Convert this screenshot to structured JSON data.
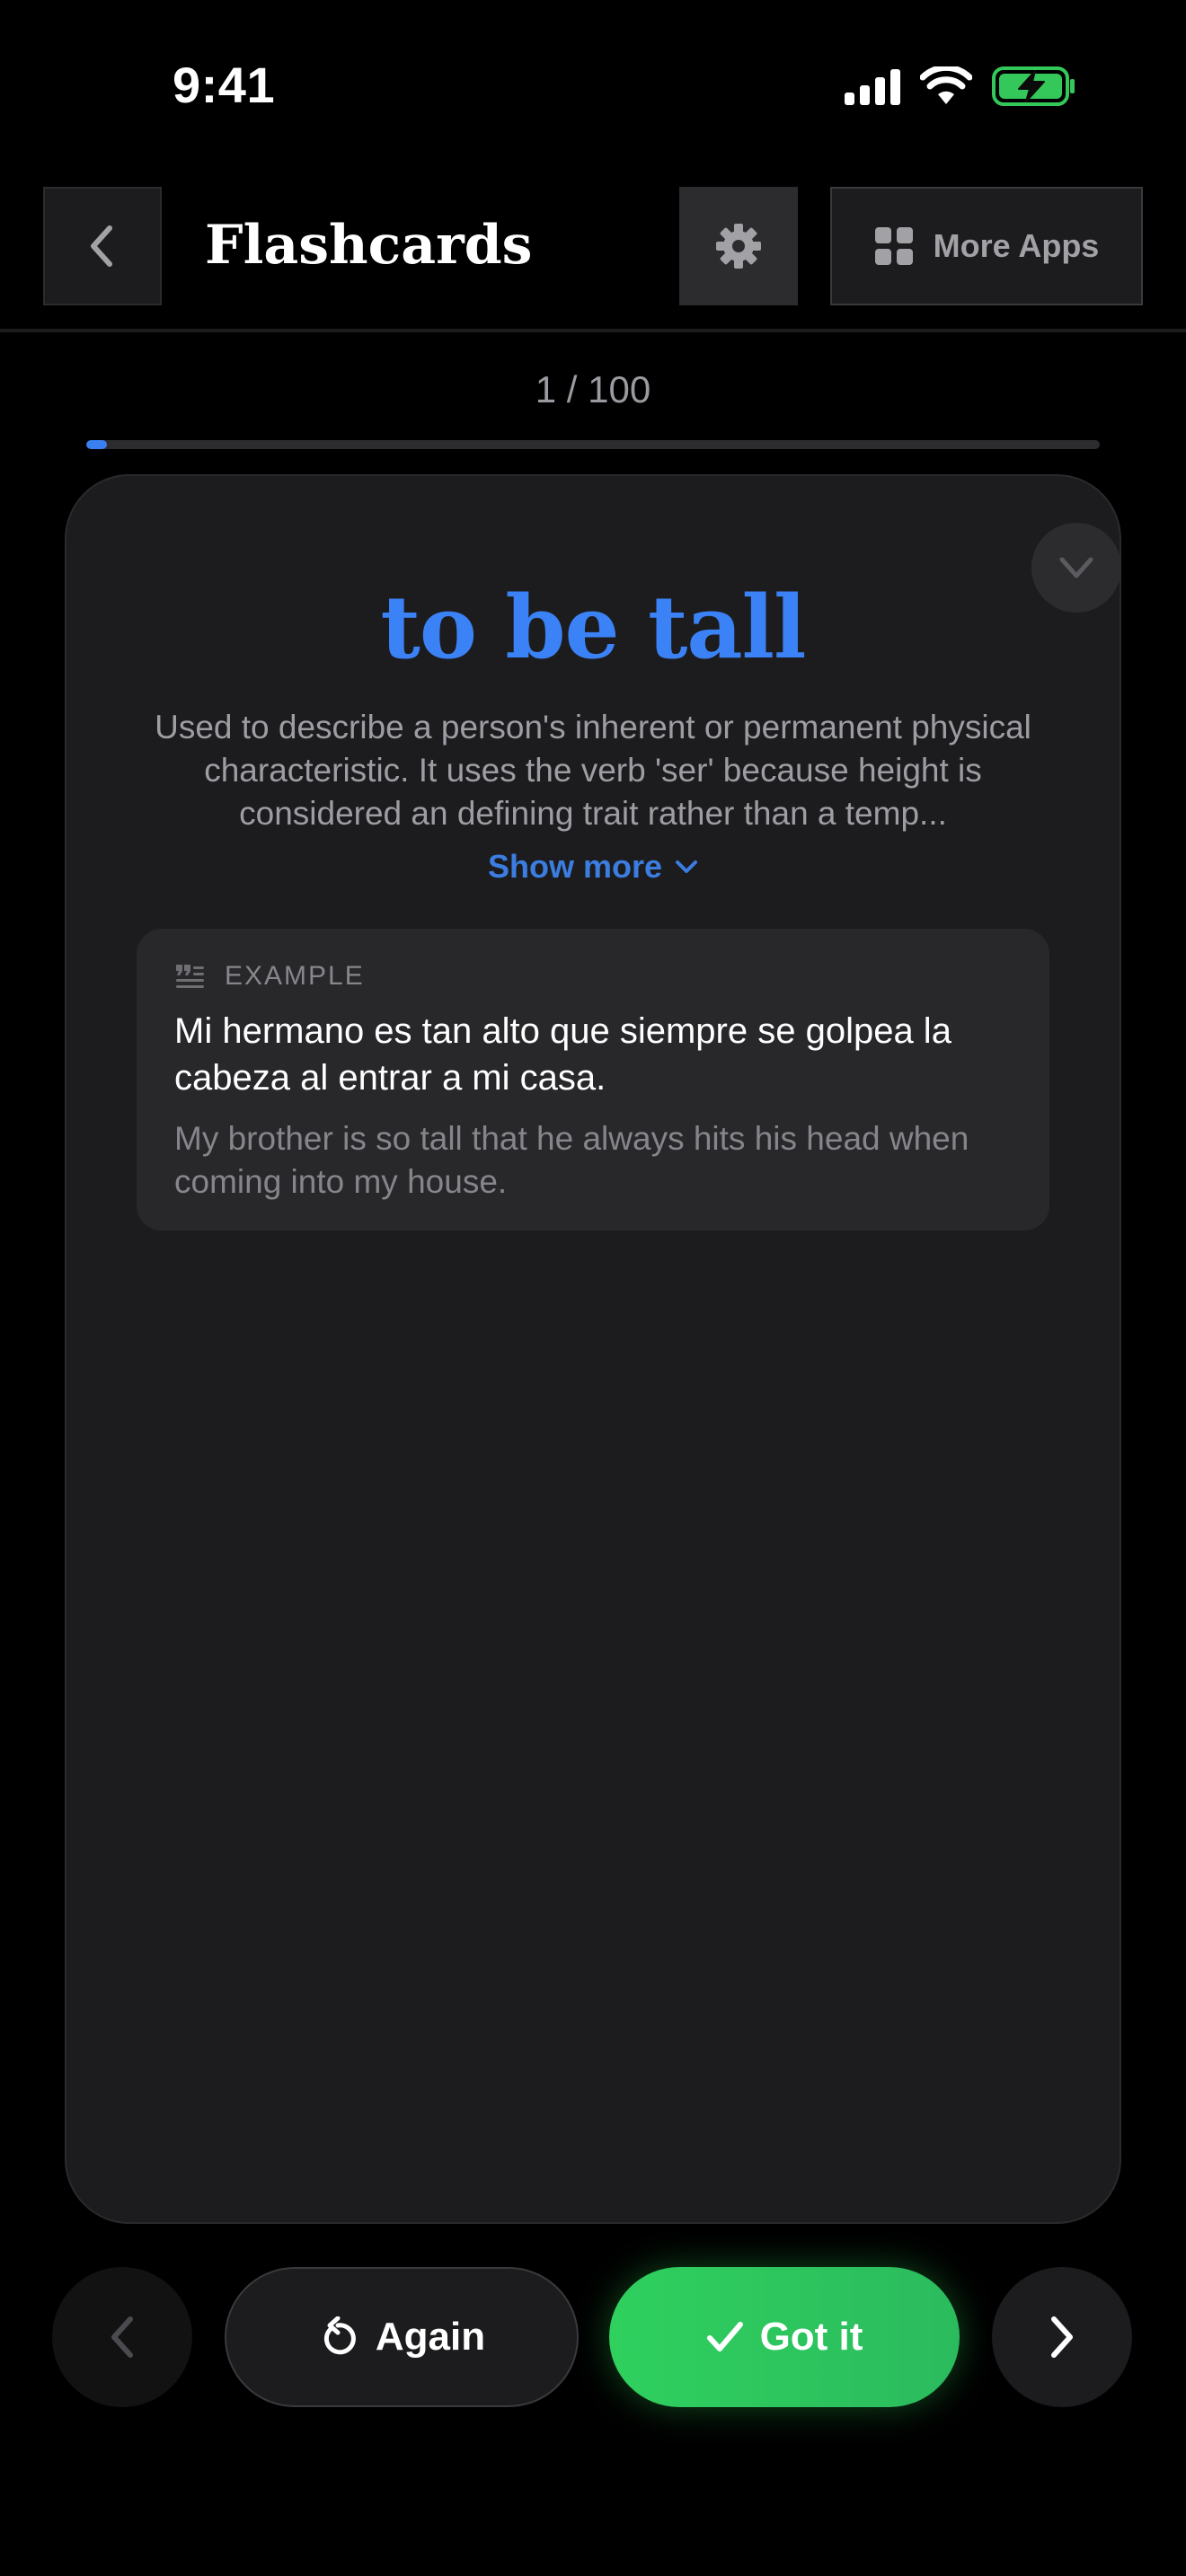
{
  "status_bar": {
    "time": "9:41",
    "icons": [
      "cellular-signal-icon",
      "wifi-icon",
      "battery-charging-icon"
    ],
    "battery_color": "#34c759"
  },
  "header": {
    "back_icon": "chevron-left-icon",
    "title": "Flashcards",
    "settings_icon": "gear-icon",
    "more_apps_icon": "grid-icon",
    "more_apps_label": "More Apps"
  },
  "progress": {
    "label": "1 / 100",
    "current": 1,
    "total": 100,
    "accent": "#3a7ff0"
  },
  "card": {
    "collapse_icon": "chevron-down-icon",
    "term": "to be tall",
    "term_color": "#3b82f6",
    "definition": "Used to describe a person's inherent or permanent physical characteristic. It uses the verb 'ser' because height is considered an defining trait rather than a temp...",
    "show_more_label": "Show more",
    "example": {
      "icon": "quote-icon",
      "label": "EXAMPLE",
      "sentence": "Mi hermano es tan alto que siempre se golpea la cabeza al entrar a mi casa.",
      "translation": "My brother is so tall that he always hits his head when coming into my house."
    }
  },
  "controls": {
    "prev_icon": "chevron-left-icon",
    "again_icon": "undo-icon",
    "again_label": "Again",
    "got_it_icon": "checkmark-icon",
    "got_it_label": "Got it",
    "got_it_color": "#30d158",
    "next_icon": "chevron-right-icon"
  }
}
